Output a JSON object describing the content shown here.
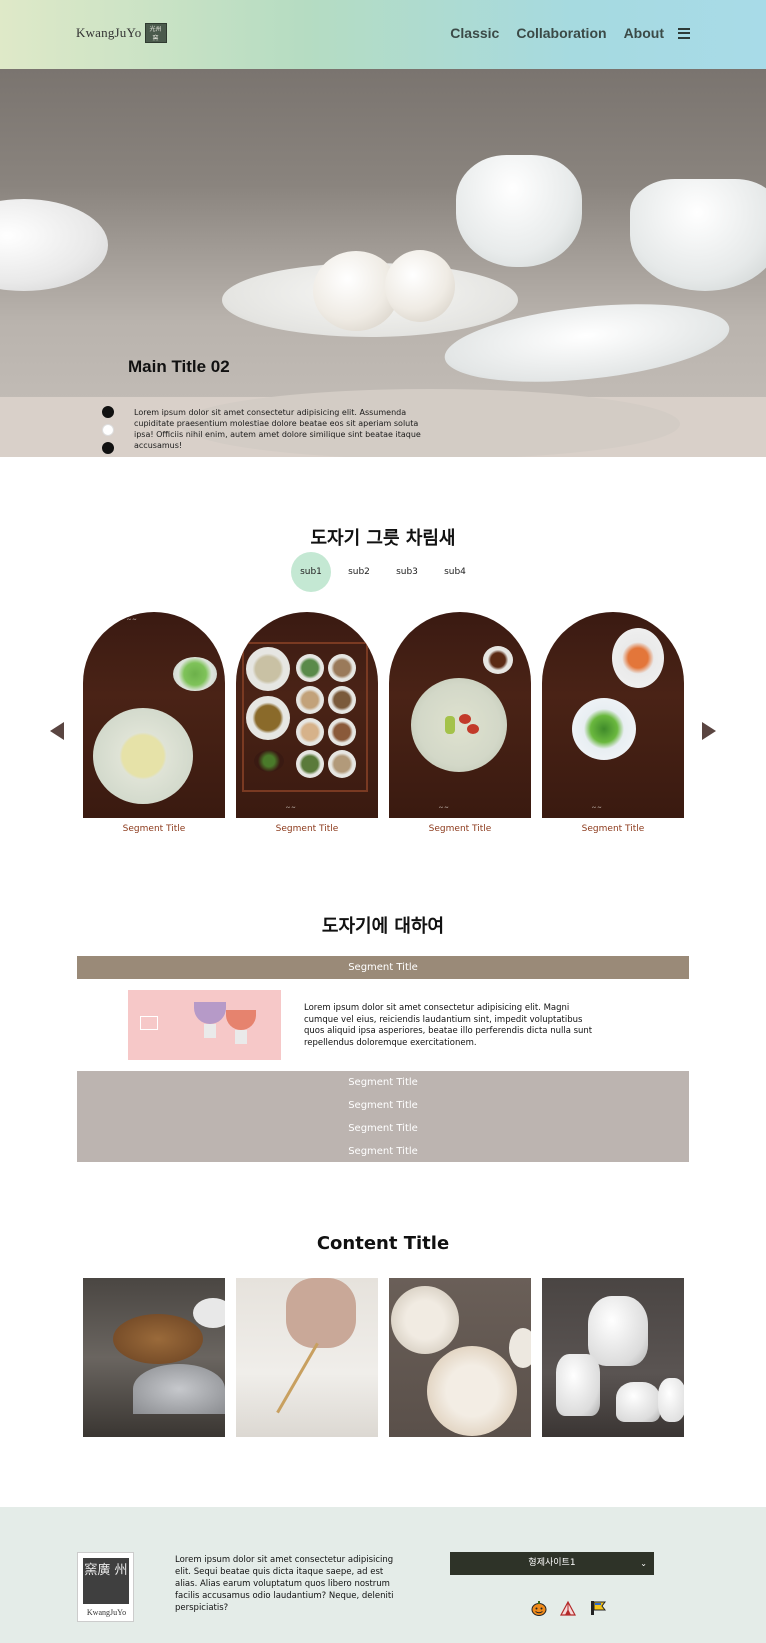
{
  "header": {
    "logo_text": "KwangJuYo",
    "logo_seal": "光州窯",
    "nav": [
      {
        "label": "Classic"
      },
      {
        "label": "Collaboration"
      },
      {
        "label": "About"
      }
    ]
  },
  "hero": {
    "title": "Main Title 02",
    "text": "Lorem ipsum dolor sit amet consectetur adipisicing elit. Assumenda cupiditate praesentium molestiae dolore beatae eos sit aperiam soluta ipsa! Officiis nihil enim, autem amet dolore similique sint beatae itaque accusamus!",
    "slides": 3,
    "active_slide": 2
  },
  "section_tableware": {
    "title": "도자기 그릇 차림새",
    "tabs": [
      {
        "label": "sub1",
        "active": true
      },
      {
        "label": "sub2",
        "active": false
      },
      {
        "label": "sub3",
        "active": false
      },
      {
        "label": "sub4",
        "active": false
      }
    ],
    "cards": [
      {
        "title": "Segment Title"
      },
      {
        "title": "Segment Title"
      },
      {
        "title": "Segment Title"
      },
      {
        "title": "Segment Title"
      }
    ]
  },
  "section_about": {
    "title": "도자기에 대하여",
    "active_segment": "Segment Title",
    "detail_text": "Lorem ipsum dolor sit amet consectetur adipisicing elit. Magni cumque vel eius, reiciendis laudantium sint, impedit voluptatibus quos aliquid ipsa asperiores, beatae illo perferendis dicta nulla sunt repellendus doloremque exercitationem.",
    "other_segments": [
      {
        "label": "Segment Title"
      },
      {
        "label": "Segment Title"
      },
      {
        "label": "Segment Title"
      },
      {
        "label": "Segment Title"
      }
    ]
  },
  "section_content": {
    "title": "Content Title"
  },
  "footer": {
    "logo_seal": "窯廣 州",
    "logo_name": "KwangJuYo",
    "text": "Lorem ipsum dolor sit amet consectetur adipisicing elit. Sequi beatae quis dicta itaque saepe, ad est alias. Alias earum voluptatum quos libero nostrum facilis accusamus odio laudantium? Neque, deleniti perspiciatis?",
    "family_site_label": "형제사이트1",
    "sns_icons": [
      "pumpkin-icon",
      "tent-icon",
      "flag-icon"
    ]
  },
  "colors": {
    "header_gradient_start": "#dfe9c8",
    "header_gradient_end": "#a8dbe8",
    "tab_active": "#c4e8d3",
    "card_title": "#8c3a1c",
    "segment_active": "#9a8a78",
    "segment_rest": "#bcb4b0",
    "footer_bg": "#e4ece8",
    "family_select_bg": "#2e3328"
  }
}
